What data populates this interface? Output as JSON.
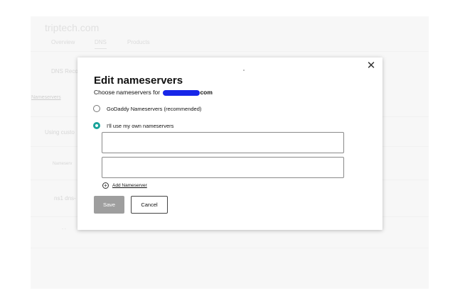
{
  "background": {
    "site_title": "triptech.com",
    "tabs": [
      {
        "label": "Overview"
      },
      {
        "label": "DNS",
        "active": true
      },
      {
        "label": "Products"
      }
    ],
    "rows": {
      "dns_records": "DNS Reco",
      "nameservers_link": "Nameservers",
      "using_custom": "Using custo",
      "nameserver_header": "Nameserv",
      "ns1": "ns1 dns-",
      "more": "-  -"
    }
  },
  "modal": {
    "title": "Edit nameservers",
    "subtitle_prefix": "Choose nameservers for",
    "domain_suffix": "com",
    "options": [
      {
        "label": "GoDaddy Nameservers (recommended)",
        "checked": false
      },
      {
        "label": "I'll use my own nameservers",
        "checked": true
      }
    ],
    "nameserver_inputs": [
      {
        "value": "",
        "placeholder": ""
      },
      {
        "value": "",
        "placeholder": ""
      }
    ],
    "add_nameserver_label": "Add Nameserver",
    "save_label": "Save",
    "cancel_label": "Cancel",
    "close_icon": "close-icon",
    "colors": {
      "accent": "#1aa39a",
      "save_disabled": "#9e9e9e",
      "redaction": "#1726e8"
    }
  }
}
